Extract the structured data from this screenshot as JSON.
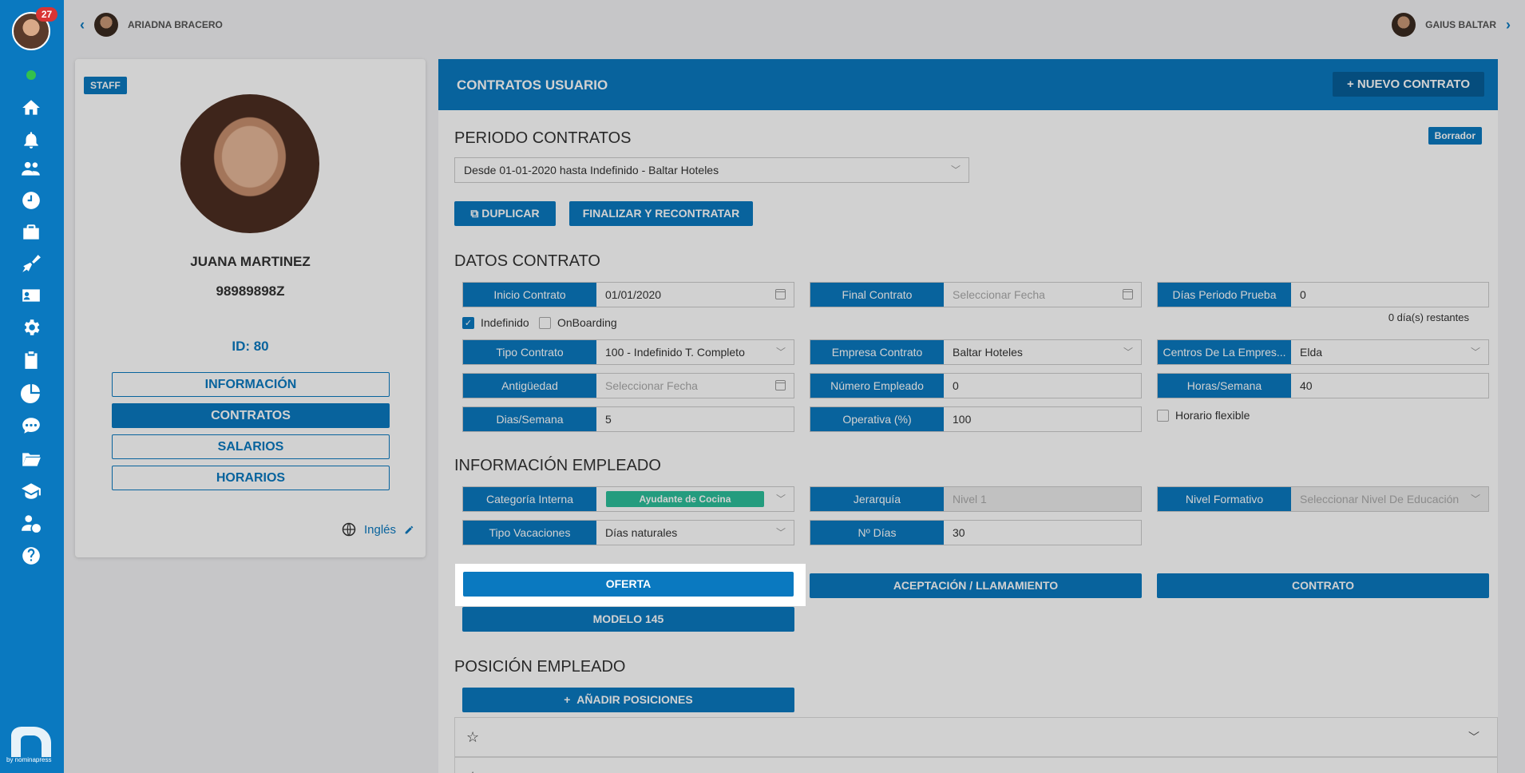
{
  "sidebar": {
    "notification_count": "27",
    "brand_by": "by nominapress",
    "icons": [
      "home-icon",
      "bell-icon",
      "users-icon",
      "clock-icon",
      "briefcase-icon",
      "broom-icon",
      "id-card-icon",
      "gear-icon",
      "clipboard-icon",
      "pie-chart-icon",
      "chat-icon",
      "folder-icon",
      "graduation-cap-icon",
      "user-money-icon",
      "help-icon"
    ]
  },
  "topbar": {
    "left_name": "ARIADNA BRACERO",
    "right_name": "GAIUS BALTAR"
  },
  "profile": {
    "tag": "STAFF",
    "name": "JUANA MARTINEZ",
    "document": "98989898Z",
    "id": "ID: 80",
    "nav": [
      "INFORMACIÓN",
      "CONTRATOS",
      "SALARIOS",
      "HORARIOS"
    ],
    "active_nav": "CONTRATOS",
    "language": "Inglés"
  },
  "contracts": {
    "header_title": "CONTRATOS USUARIO",
    "new_button": "NUEVO CONTRATO",
    "periodo_title": "PERIODO CONTRATOS",
    "status_badge": "Borrador",
    "periodo_selected": "Desde 01-01-2020 hasta Indefinido - Baltar Hoteles",
    "duplicate_button": "DUPLICAR",
    "finalize_button": "FINALIZAR Y RECONTRATAR",
    "datos_title": "DATOS CONTRATO",
    "fields": {
      "inicio_label": "Inicio Contrato",
      "inicio_value": "01/01/2020",
      "final_label": "Final Contrato",
      "final_placeholder": "Seleccionar Fecha",
      "prueba_label": "Días Periodo Prueba",
      "prueba_value": "0",
      "restantes": "0 día(s) restantes",
      "indefinido": "Indefinido",
      "onboarding": "OnBoarding",
      "tipo_label": "Tipo Contrato",
      "tipo_value": "100 - Indefinido T. Completo",
      "empresa_label": "Empresa Contrato",
      "empresa_value": "Baltar Hoteles",
      "centros_label": "Centros De La Empres...",
      "centros_value": "Elda",
      "antiguedad_label": "Antigüedad",
      "antiguedad_placeholder": "Seleccionar Fecha",
      "numero_label": "Número Empleado",
      "numero_value": "0",
      "horas_label": "Horas/Semana",
      "horas_value": "40",
      "dias_label": "Dias/Semana",
      "dias_value": "5",
      "operativa_label": "Operativa (%)",
      "operativa_value": "100",
      "flexible": "Horario flexible"
    },
    "info_title": "INFORMACIÓN EMPLEADO",
    "info": {
      "categoria_label": "Categoría Interna",
      "categoria_value": "Ayudante de Cocina",
      "jerarquia_label": "Jerarquía",
      "jerarquia_value": "Nivel 1",
      "nivel_label": "Nivel Formativo",
      "nivel_placeholder": "Seleccionar Nivel De Educación",
      "vacaciones_label": "Tipo Vacaciones",
      "vacaciones_value": "Días naturales",
      "ndias_label": "Nº Días",
      "ndias_value": "30"
    },
    "doc_buttons": {
      "oferta": "OFERTA",
      "aceptacion": "ACEPTACIÓN / LLAMAMIENTO",
      "contrato": "CONTRATO",
      "modelo": "MODELO 145"
    },
    "posicion_title": "POSICIÓN EMPLEADO",
    "add_positions": "AÑADIR POSICIONES"
  }
}
